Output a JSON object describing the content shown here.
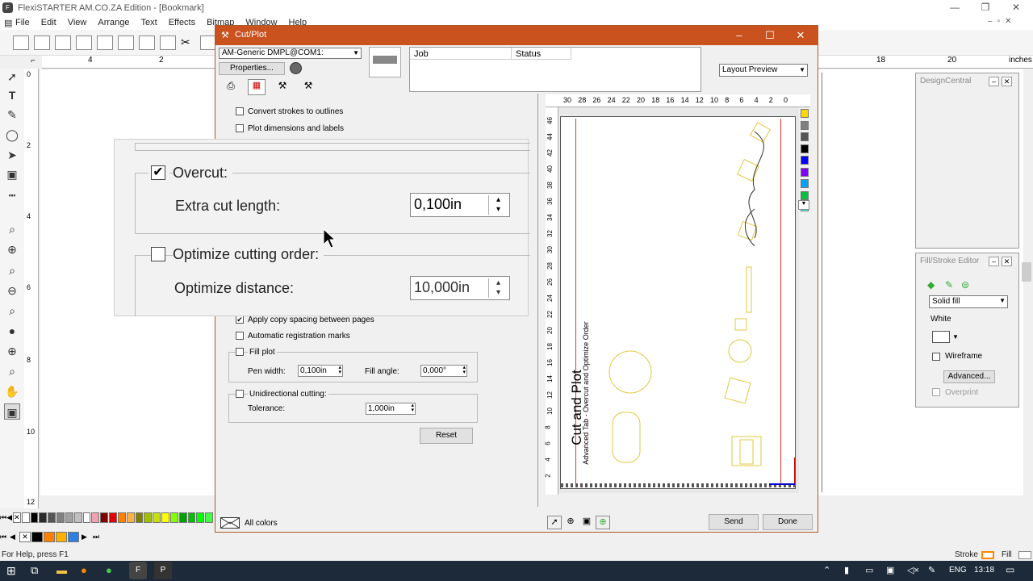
{
  "app": {
    "title": "FlexiSTARTER AM.CO.ZA Edition - [Bookmark]",
    "menu": [
      "File",
      "Edit",
      "View",
      "Arrange",
      "Text",
      "Effects",
      "Bitmap",
      "Window",
      "Help"
    ],
    "ruler_unit": "inches",
    "ruler_top_labels": [
      "4",
      "2",
      "18",
      "20"
    ],
    "ruler_left_labels": [
      "0",
      "2",
      "4",
      "6",
      "8",
      "10",
      "12"
    ]
  },
  "design_central": {
    "title": "DesignCentral"
  },
  "fill_stroke": {
    "title": "Fill/Stroke Editor",
    "fill_type": "Solid fill",
    "color_name": "White",
    "wireframe_label": "Wireframe",
    "advanced_label": "Advanced...",
    "overprint_label": "Overprint"
  },
  "palette_colors": [
    "#ffffff",
    "#000000",
    "#2b2b2b",
    "#555555",
    "#808080",
    "#a0a0a0",
    "#c0c0c0",
    "#ffffff",
    "#f0a0b0",
    "#800000",
    "#e00000",
    "#ff8000",
    "#ffb040",
    "#808000",
    "#a0c000",
    "#c8e000",
    "#ffff00",
    "#80ff00",
    "#00a000",
    "#00c000",
    "#00ff00",
    "#40ff40"
  ],
  "palette2_colors": [
    "#000000",
    "#ff8000",
    "#ffb000",
    "#3080e0"
  ],
  "statusbar": {
    "help": "For Help, press F1",
    "stroke_label": "Stroke",
    "fill_label": "Fill"
  },
  "taskbar": {
    "lang": "ENG",
    "time": "13:18"
  },
  "dialog": {
    "title": "Cut/Plot",
    "device": "AM-Generic DMPL@COM1:",
    "properties_label": "Properties...",
    "job_col": "Job",
    "status_col": "Status",
    "view_mode": "Layout Preview",
    "options": {
      "convert_strokes": "Convert strokes to outlines",
      "plot_dimensions": "Plot dimensions and labels",
      "apply_copy_spacing": "Apply copy spacing between pages",
      "registration_marks": "Automatic registration marks",
      "fill_plot": "Fill plot",
      "pen_width_label": "Pen width:",
      "pen_width": "0,100in",
      "fill_angle_label": "Fill angle:",
      "fill_angle": "0,000°",
      "unidirectional": "Unidirectional cutting:",
      "tolerance_label": "Tolerance:",
      "tolerance": "1,000in",
      "reset_label": "Reset"
    },
    "zoomed": {
      "overcut_label": "Overcut:",
      "extra_cut_label": "Extra cut length:",
      "extra_cut_value": "0,100in",
      "optimize_label": "Optimize cutting order:",
      "optimize_distance_label": "Optimize distance:",
      "optimize_distance_value": "10,000in"
    },
    "preview": {
      "ruler_top": [
        "30",
        "28",
        "26",
        "24",
        "22",
        "20",
        "18",
        "16",
        "14",
        "12",
        "10",
        "8",
        "6",
        "4",
        "2",
        "0"
      ],
      "ruler_left": [
        "46",
        "44",
        "42",
        "40",
        "38",
        "36",
        "34",
        "32",
        "30",
        "28",
        "26",
        "24",
        "22",
        "20",
        "18",
        "16",
        "14",
        "12",
        "10",
        "8",
        "6",
        "4",
        "2"
      ],
      "text_main": "Cut and Plot",
      "text_sub": "Advanced Tab - Overcut and Optimize Order",
      "swatches": [
        "#ffd700",
        "#808080",
        "#555555",
        "#000000",
        "#0000ff",
        "#8000ff",
        "#00a0ff",
        "#00c040",
        "#40ffff"
      ]
    },
    "all_colors": "All colors",
    "send_label": "Send",
    "done_label": "Done"
  }
}
